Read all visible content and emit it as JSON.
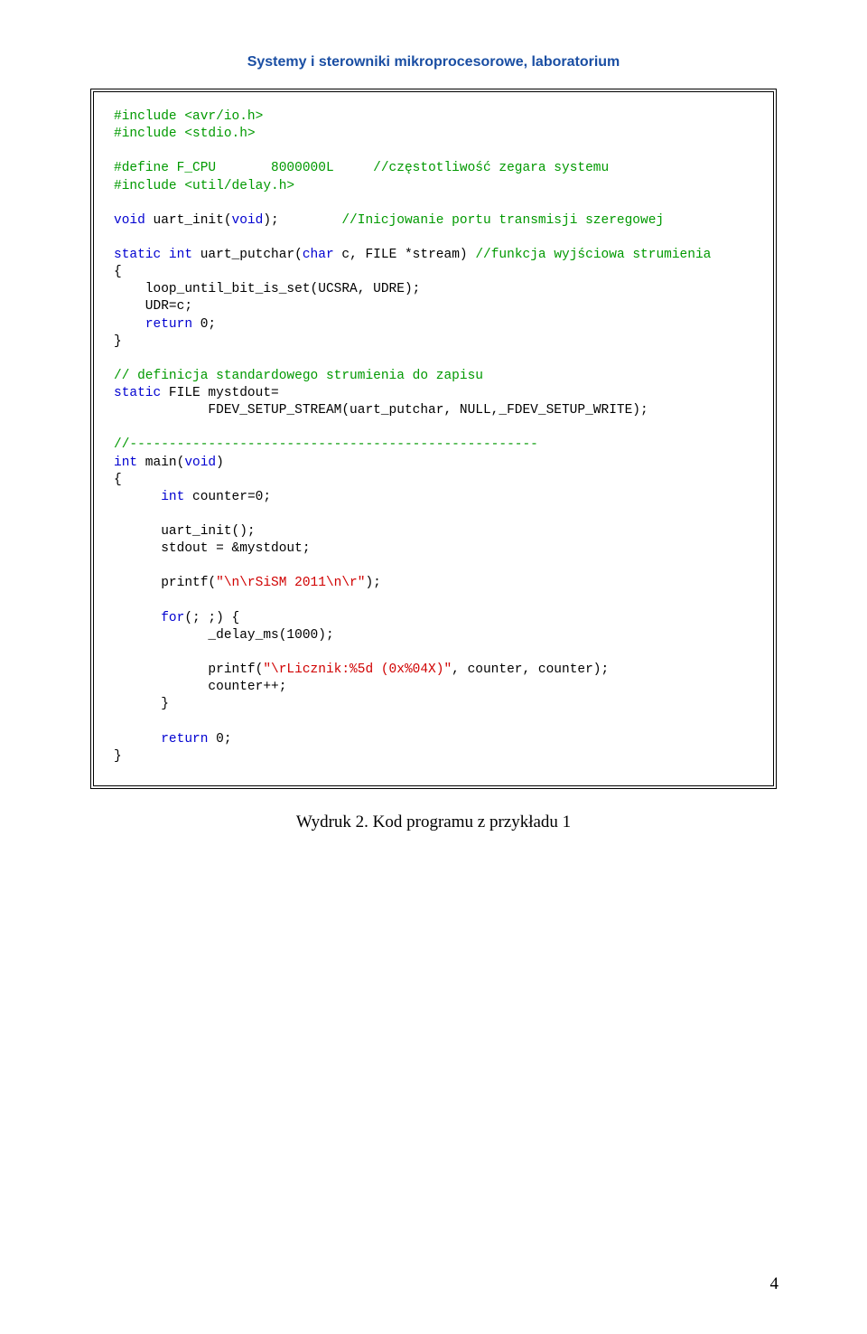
{
  "header": {
    "title": "Systemy i sterowniki mikroprocesorowe, laboratorium"
  },
  "code": {
    "l01": "#include <avr/io.h>",
    "l02": "#include <stdio.h>",
    "l03_a": "#define F_CPU       8000000L     ",
    "l03_b": "//częstotliwość zegara systemu",
    "l04": "#include <util/delay.h>",
    "l05_a": "void",
    "l05_b": " uart_init(",
    "l05_c": "void",
    "l05_d": ");        ",
    "l05_e": "//Inicjowanie portu transmisji szeregowej",
    "l06_a": "static",
    "l06_b": " ",
    "l06_c": "int",
    "l06_d": " uart_putchar(",
    "l06_e": "char",
    "l06_f": " c, FILE *stream) ",
    "l06_g": "//funkcja wyjściowa strumienia",
    "l07": "{",
    "l08": "    loop_until_bit_is_set(UCSRA, UDRE);",
    "l09": "    UDR=c;",
    "l10_a": "    ",
    "l10_b": "return",
    "l10_c": " 0;",
    "l11": "}",
    "l12": "// definicja standardowego strumienia do zapisu",
    "l13_a": "static",
    "l13_b": " FILE mystdout=",
    "l14": "            FDEV_SETUP_STREAM(uart_putchar, NULL,_FDEV_SETUP_WRITE);",
    "l15": "//----------------------------------------------------",
    "l16_a": "int",
    "l16_b": " main(",
    "l16_c": "void",
    "l16_d": ")",
    "l17": "{",
    "l18_a": "      ",
    "l18_b": "int",
    "l18_c": " counter=0;",
    "l19": "      uart_init();",
    "l20": "      stdout = &mystdout;",
    "l21_a": "      printf(",
    "l21_b": "\"\\n\\rSiSM 2011\\n\\r\"",
    "l21_c": ");",
    "l22_a": "      ",
    "l22_b": "for",
    "l22_c": "(; ;) {",
    "l23": "            _delay_ms(1000);",
    "l24_a": "            printf(",
    "l24_b": "\"\\rLicznik:%5d (0x%04X)\"",
    "l24_c": ", counter, counter);",
    "l25": "            counter++;",
    "l26": "      }",
    "l27_a": "      ",
    "l27_b": "return",
    "l27_c": " 0;",
    "l28": "}"
  },
  "caption": "Wydruk 2. Kod programu z przykładu 1",
  "page_number": "4"
}
